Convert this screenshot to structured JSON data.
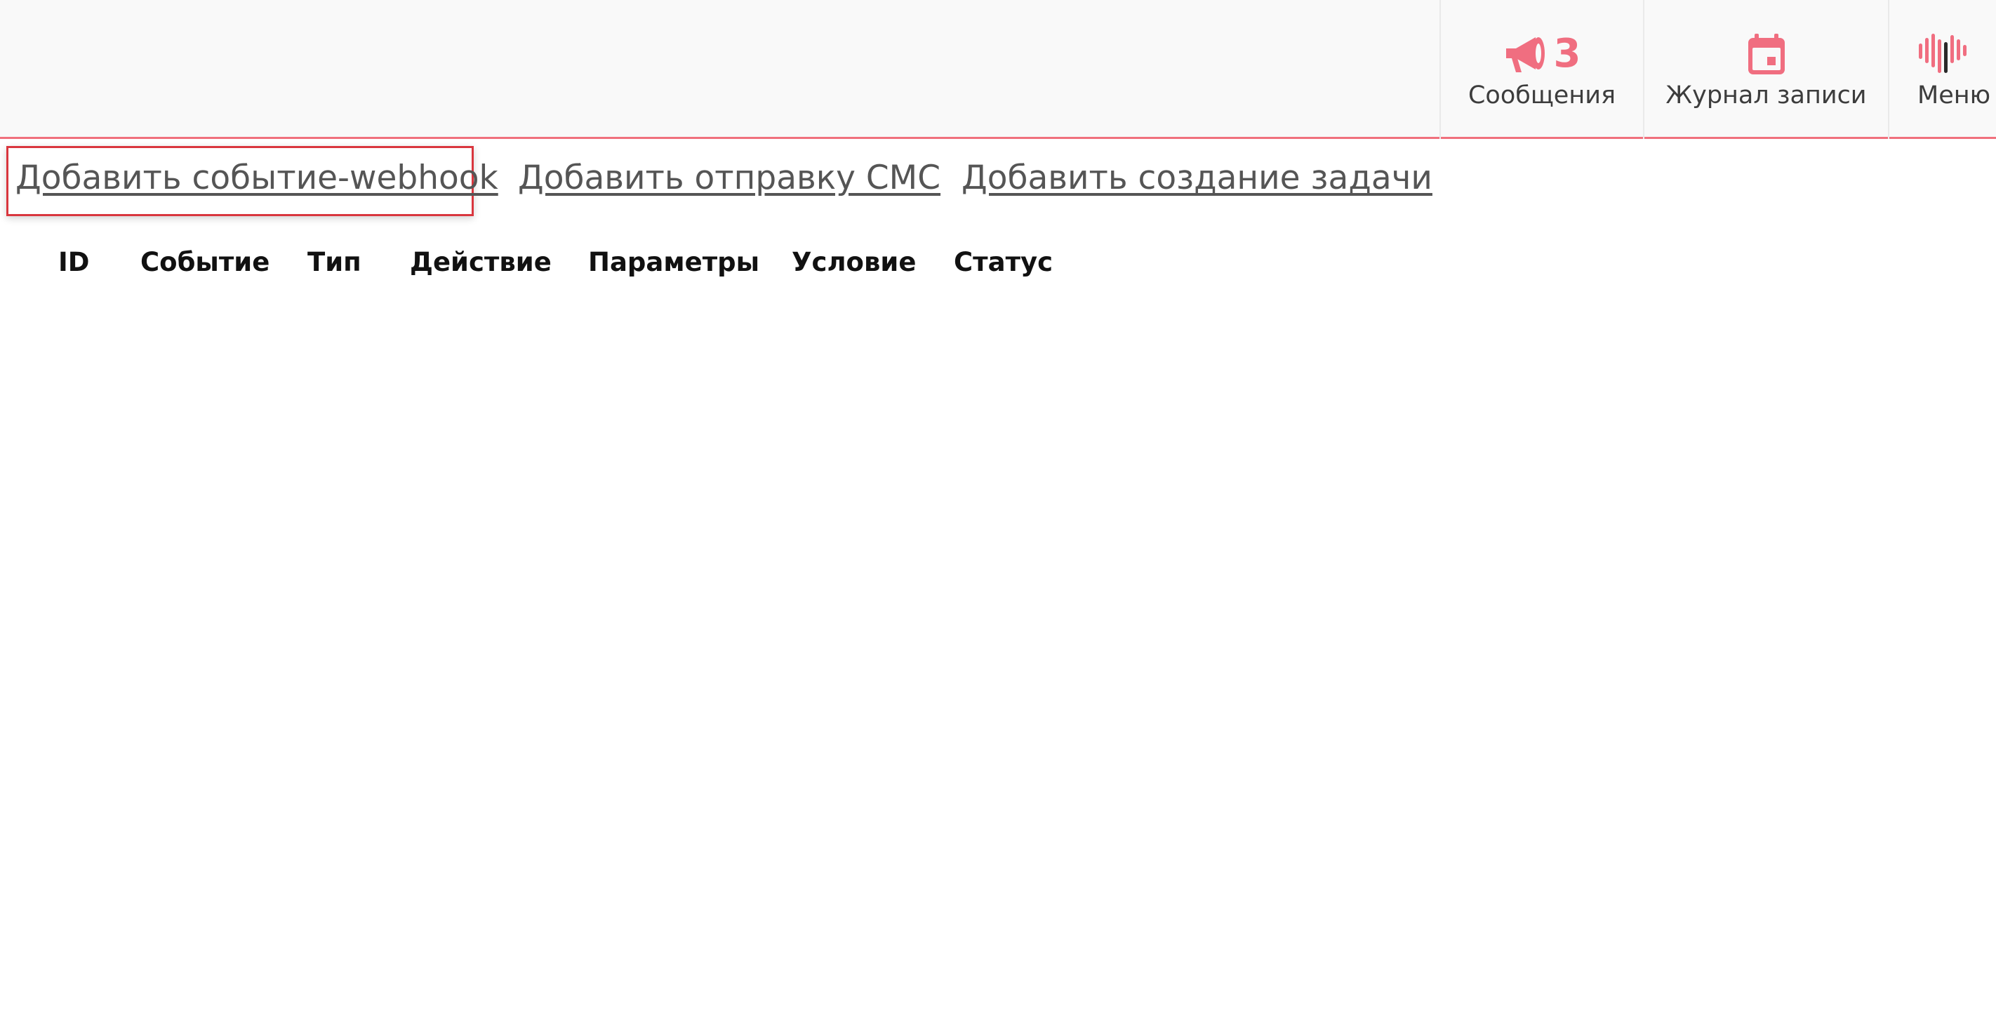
{
  "header": {
    "messages": {
      "label": "Сообщения",
      "count": "3",
      "icon": "megaphone-icon"
    },
    "journal": {
      "label": "Журнал записи",
      "icon": "calendar-icon"
    },
    "menu": {
      "label": "Меню",
      "icon": "menu-logo-icon"
    }
  },
  "actions": {
    "add_webhook": "Добавить событие-webhook",
    "add_sms": "Добавить отправку СМС",
    "add_task": "Добавить создание задачи"
  },
  "table": {
    "columns": [
      "ID",
      "Событие",
      "Тип",
      "Действие",
      "Параметры",
      "Условие",
      "Статус"
    ],
    "rows": []
  },
  "colors": {
    "accent": "#f06e80",
    "highlight": "#d9363e",
    "link": "#555555"
  }
}
